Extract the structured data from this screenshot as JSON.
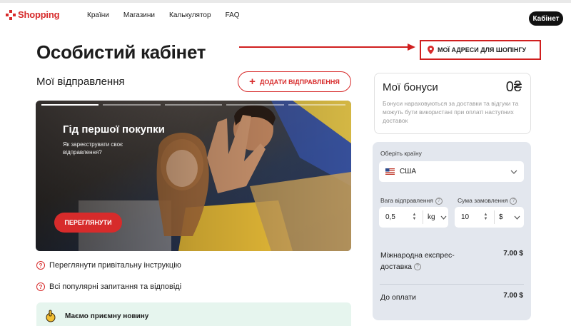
{
  "header": {
    "logo_text": "Shopping",
    "nav": [
      "Країни",
      "Магазини",
      "Калькулятор",
      "FAQ"
    ],
    "cabinet_label": "Кабінет"
  },
  "page": {
    "title": "Особистий кабінет",
    "addresses_button": "МОЇ АДРЕСИ ДЛЯ ШОПІНГУ",
    "shipments_title": "Мої відправлення",
    "add_shipment_button": "ДОДАТИ ВІДПРАВЛЕННЯ"
  },
  "banner": {
    "title": "Гід першої покупки",
    "subtitle": "Як зареєструвати своє відправлення?",
    "button": "ПЕРЕГЛЯНУТИ",
    "slides_count": 5,
    "active_slide": 1
  },
  "help_links": [
    "Переглянути привітальну інструкцію",
    "Всі популярні запитання та відповіді"
  ],
  "news": {
    "title": "Маємо приємну новину"
  },
  "bonus": {
    "title": "Мої бонуси",
    "value": "0₴",
    "description": "Бонуси нараховуються за доставки та відгуки та можуть бути використані при оплаті наступних доставок"
  },
  "calculator": {
    "country_label": "Оберіть країну",
    "country_value": "США",
    "weight_label": "Вага відправлення",
    "weight_value": "0,5",
    "weight_unit": "kg",
    "order_label": "Сума замовлення",
    "order_value": "10",
    "order_currency": "$",
    "express_label": "Міжнародна експрес-доставка",
    "express_value": "7.00 $",
    "total_label": "До оплати",
    "total_value": "7.00 $"
  },
  "colors": {
    "accent": "#d72b2b",
    "calc_bg": "#e3e7ee",
    "news_bg": "#e6f5ee"
  }
}
